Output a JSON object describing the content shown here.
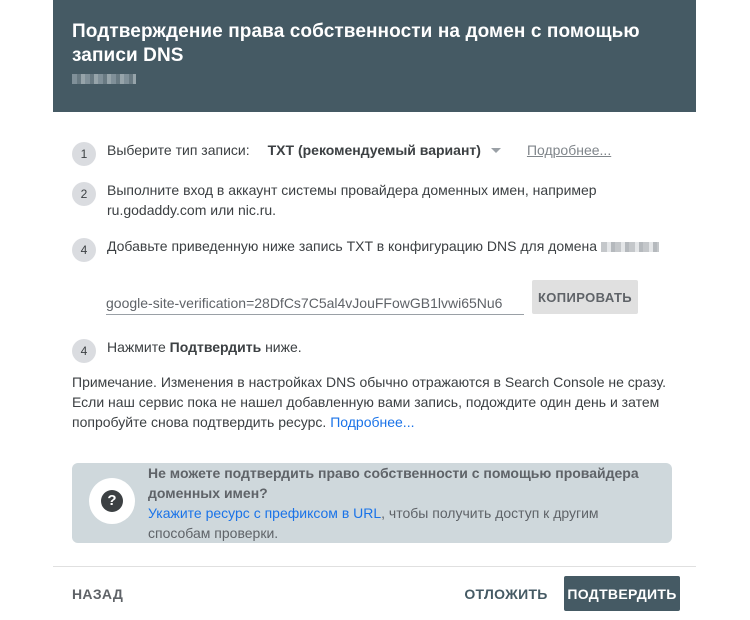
{
  "header": {
    "title": "Подтверждение права собственности на домен с помощью записи DNS"
  },
  "steps": [
    {
      "number": "1",
      "label": "Выберите тип записи:",
      "record_type": "TXT (рекомендуемый вариант)",
      "more_link": "Подробнее..."
    },
    {
      "number": "2",
      "text_line1": "Выполните вход в аккаунт системы провайдера доменных имен, например",
      "text_line2": "ru.godaddy.com или nic.ru."
    },
    {
      "number": "4",
      "text": "Добавьте приведенную ниже запись TXT в конфигурацию DNS для домена"
    },
    {
      "number": "4",
      "text_prefix": "Нажмите ",
      "text_bold": "Подтвердить",
      "text_suffix": " ниже."
    }
  ],
  "verification": {
    "value": "google-site-verification=28DfCs7C5al4vJouFFowGB1lvwi65Nu6",
    "copy_label": "КОПИРОВАТЬ"
  },
  "note": {
    "line1": "Примечание. Изменения в настройках DNS обычно отражаются в Search Console не сразу.",
    "line2": "Если наш сервис пока не нашел добавленную вами запись, подождите один день и затем",
    "line3": "попробуйте снова подтвердить ресурс.",
    "link": "Подробнее..."
  },
  "help": {
    "icon": "help-circle-icon",
    "title_line1": "Не можете подтвердить право собственности с помощью провайдера",
    "title_line2": "доменных имен?",
    "link": "Укажите ресурс с префиксом в URL",
    "text_after_link": ", чтобы получить доступ к другим",
    "text_line2": "способам проверки."
  },
  "footer": {
    "back_label": "НАЗАД",
    "later_label": "ОТЛОЖИТЬ",
    "confirm_label": "ПОДТВЕРДИТЬ"
  },
  "colors": {
    "header_bg": "#455a64",
    "help_bg": "#cfd8dc",
    "link": "#1a73e8",
    "confirm_bg": "#455a64"
  }
}
